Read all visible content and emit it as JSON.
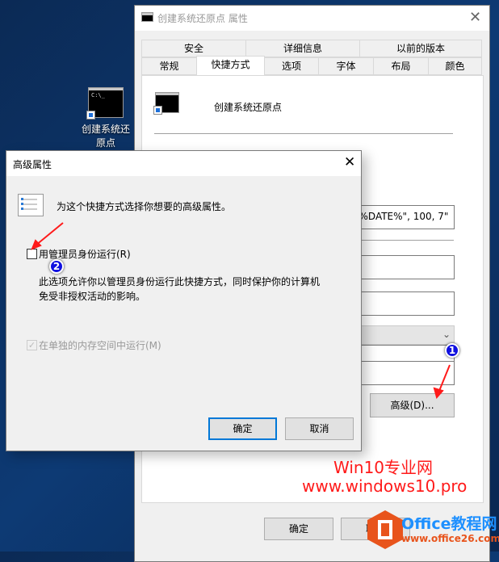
{
  "desktop": {
    "icon_label_line1": "创建系统还",
    "icon_label_line2": "原点",
    "icon_glyph": "C:\\_"
  },
  "main_window": {
    "title": "创建系统还原点 属性",
    "tabs_row1": [
      "安全",
      "详细信息",
      "以前的版本"
    ],
    "tabs_row2": [
      "常规",
      "快捷方式",
      "选项",
      "字体",
      "布局",
      "颜色"
    ],
    "selected_tab": "快捷方式",
    "shortcut_name": "创建系统还原点",
    "target_value": "\"%DATE%\", 100, 7\"",
    "advanced_button": "高级(D)...",
    "ok_button": "确定",
    "cancel_button": "取消"
  },
  "dialog": {
    "title": "高级属性",
    "intro": "为这个快捷方式选择你想要的高级属性。",
    "run_as_admin_label": "用管理员身份运行(R)",
    "run_as_admin_checked": false,
    "description_line1": "此选项允许你以管理员身份运行此快捷方式，同时保护你的计算机",
    "description_line2": "免受非授权活动的影响。",
    "separate_memory_label": "在单独的内存空间中运行(M)",
    "separate_memory_checked": true,
    "ok_button": "确定",
    "cancel_button": "取消"
  },
  "annotations": {
    "badge1": "1",
    "badge2": "2",
    "arrow_color": "#ff1a1a"
  },
  "watermark": {
    "line1": "Win10专业网",
    "line2": "www.windows10.pro",
    "logo_title": "Office教程网",
    "logo_url": "www.office26.com"
  }
}
